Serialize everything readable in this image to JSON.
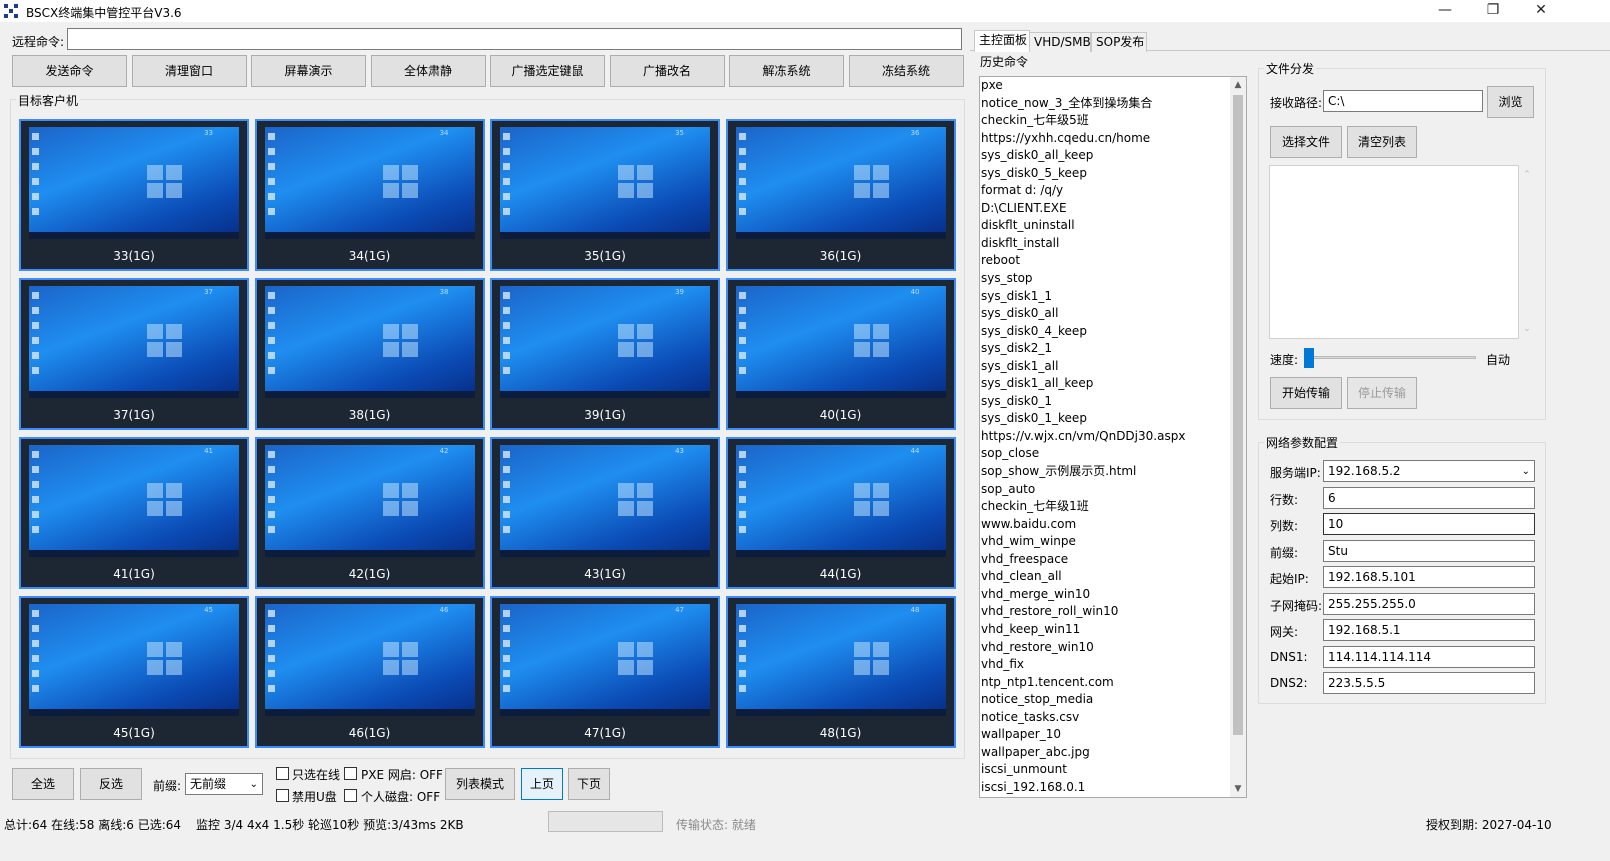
{
  "window": {
    "title": "BSCX终端集中管控平台V3.6",
    "min": "—",
    "max": "❐",
    "close": "✕"
  },
  "command": {
    "label": "远程命令:",
    "value": ""
  },
  "toolbar": [
    "发送命令",
    "清理窗口",
    "屏幕演示",
    "全体肃静",
    "广播选定键鼠",
    "广播改名",
    "解冻系统",
    "冻结系统"
  ],
  "clients": {
    "group_title": "目标客户机",
    "tiles": [
      {
        "num": "33",
        "label": "33(1G)"
      },
      {
        "num": "34",
        "label": "34(1G)"
      },
      {
        "num": "35",
        "label": "35(1G)"
      },
      {
        "num": "36",
        "label": "36(1G)"
      },
      {
        "num": "37",
        "label": "37(1G)"
      },
      {
        "num": "38",
        "label": "38(1G)"
      },
      {
        "num": "39",
        "label": "39(1G)"
      },
      {
        "num": "40",
        "label": "40(1G)"
      },
      {
        "num": "41",
        "label": "41(1G)"
      },
      {
        "num": "42",
        "label": "42(1G)"
      },
      {
        "num": "43",
        "label": "43(1G)"
      },
      {
        "num": "44",
        "label": "44(1G)"
      },
      {
        "num": "45",
        "label": "45(1G)"
      },
      {
        "num": "46",
        "label": "46(1G)"
      },
      {
        "num": "47",
        "label": "47(1G)"
      },
      {
        "num": "48",
        "label": "48(1G)"
      }
    ]
  },
  "bottom": {
    "select_all": "全选",
    "invert": "反选",
    "prefix_label": "前缀:",
    "prefix_value": "无前缀",
    "only_online": "只选在线",
    "pxe_wake": "PXE 网启: OFF",
    "disable_usb": "禁用U盘",
    "personal_disk": "个人磁盘: OFF",
    "list_mode": "列表模式",
    "prev_page": "上页",
    "next_page": "下页"
  },
  "tabs": [
    "主控面板",
    "VHD/SMB",
    "SOP发布"
  ],
  "history": {
    "title": "历史命令",
    "items": [
      "pxe",
      "notice_now_3_全体到操场集合",
      "checkin_七年级5班",
      "https://yxhh.cqedu.cn/home",
      "sys_disk0_all_keep",
      "sys_disk0_5_keep",
      "format d: /q/y",
      "D:\\CLIENT.EXE",
      "diskflt_uninstall",
      "diskflt_install",
      "reboot",
      "sys_stop",
      "sys_disk1_1",
      "sys_disk0_all",
      "sys_disk0_4_keep",
      "sys_disk2_1",
      "sys_disk1_all",
      "sys_disk1_all_keep",
      "sys_disk0_1",
      "sys_disk0_1_keep",
      "https://v.wjx.cn/vm/QnDDj30.aspx",
      "sop_close",
      "sop_show_示例展示页.html",
      "sop_auto",
      "checkin_七年级1班",
      "www.baidu.com",
      "vhd_wim_winpe",
      "vhd_freespace",
      "vhd_clean_all",
      "vhd_merge_win10",
      "vhd_restore_roll_win10",
      "vhd_keep_win11",
      "vhd_restore_win10",
      "vhd_fix",
      "ntp_ntp1.tencent.com",
      "notice_stop_media",
      "notice_tasks.csv",
      "wallpaper_10",
      "wallpaper_abc.jpg",
      "iscsi_unmount",
      "iscsi_192.168.0.1"
    ]
  },
  "file_dist": {
    "title": "文件分发",
    "path_label": "接收路径:",
    "path_value": "C:\\",
    "browse": "浏览",
    "choose_file": "选择文件",
    "clear_list": "清空列表",
    "speed_label": "速度:",
    "speed_mode": "自动",
    "start": "开始传输",
    "stop": "停止传输"
  },
  "network": {
    "title": "网络参数配置",
    "fields": [
      {
        "label": "服务端IP:",
        "value": "192.168.5.2"
      },
      {
        "label": "行数:",
        "value": "6"
      },
      {
        "label": "列数:",
        "value": "10"
      },
      {
        "label": "前缀:",
        "value": "Stu"
      },
      {
        "label": "起始IP:",
        "value": "192.168.5.101"
      },
      {
        "label": "子网掩码:",
        "value": "255.255.255.0"
      },
      {
        "label": "网关:",
        "value": "192.168.5.1"
      },
      {
        "label": "DNS1:",
        "value": "114.114.114.114"
      },
      {
        "label": "DNS2:",
        "value": "223.5.5.5"
      }
    ]
  },
  "status": {
    "summary": "总计:64 在线:58 离线:6 已选:64",
    "monitor": "监控 3/4 4x4 1.5秒 轮巡10秒 预览:3/43ms 2KB",
    "transfer": "传输状态: 就绪",
    "license": "授权到期: 2027-04-10"
  },
  "colors": {
    "tile_border": "#3b8cff",
    "tile_bg": "#1d2733",
    "desktop": "#1f8ef0",
    "accent": "#0078d7"
  }
}
